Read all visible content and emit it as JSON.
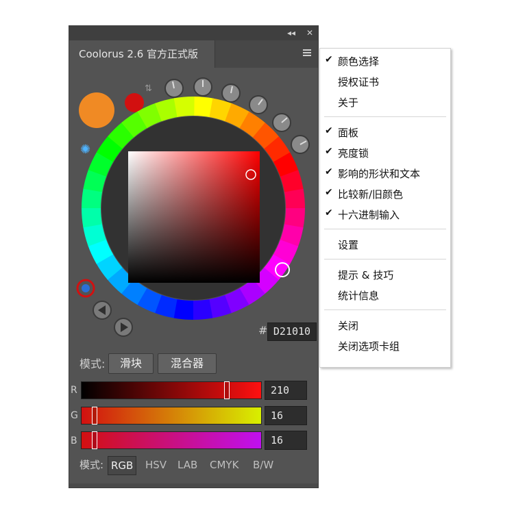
{
  "panel": {
    "title": "Coolorus 2.6 官方正式版",
    "collapse_glyph": "◂◂",
    "close_glyph": "✕"
  },
  "color": {
    "hex_prefix": "#",
    "hex_value": "D21010",
    "current_hex": "#d21010",
    "previous_hex": "#f08a24"
  },
  "mode_row1": {
    "label": "模式:",
    "buttons": [
      "滑块",
      "混合器"
    ]
  },
  "channels": [
    {
      "name": "R",
      "value": "210",
      "level": 0.82
    },
    {
      "name": "G",
      "value": "16",
      "level": 0.06
    },
    {
      "name": "B",
      "value": "16",
      "level": 0.06
    }
  ],
  "mode_row2": {
    "label": "模式:",
    "tabs": [
      "RGB",
      "HSV",
      "LAB",
      "CMYK",
      "B/W"
    ],
    "active": "RGB"
  },
  "context_menu": {
    "groups": [
      [
        {
          "label": "颜色选择",
          "checked": true
        },
        {
          "label": "授权证书",
          "checked": false
        },
        {
          "label": "关于",
          "checked": false
        }
      ],
      [
        {
          "label": "面板",
          "checked": true
        },
        {
          "label": "亮度锁",
          "checked": true
        },
        {
          "label": "影响的形状和文本",
          "checked": true
        },
        {
          "label": "比较新/旧颜色",
          "checked": true
        },
        {
          "label": "十六进制输入",
          "checked": true
        }
      ],
      [
        {
          "label": "设置",
          "checked": false
        }
      ],
      [
        {
          "label": "提示 & 技巧",
          "checked": false
        },
        {
          "label": "统计信息",
          "checked": false
        }
      ],
      [
        {
          "label": "关闭",
          "checked": false
        },
        {
          "label": "关闭选项卡组",
          "checked": false
        }
      ]
    ]
  }
}
